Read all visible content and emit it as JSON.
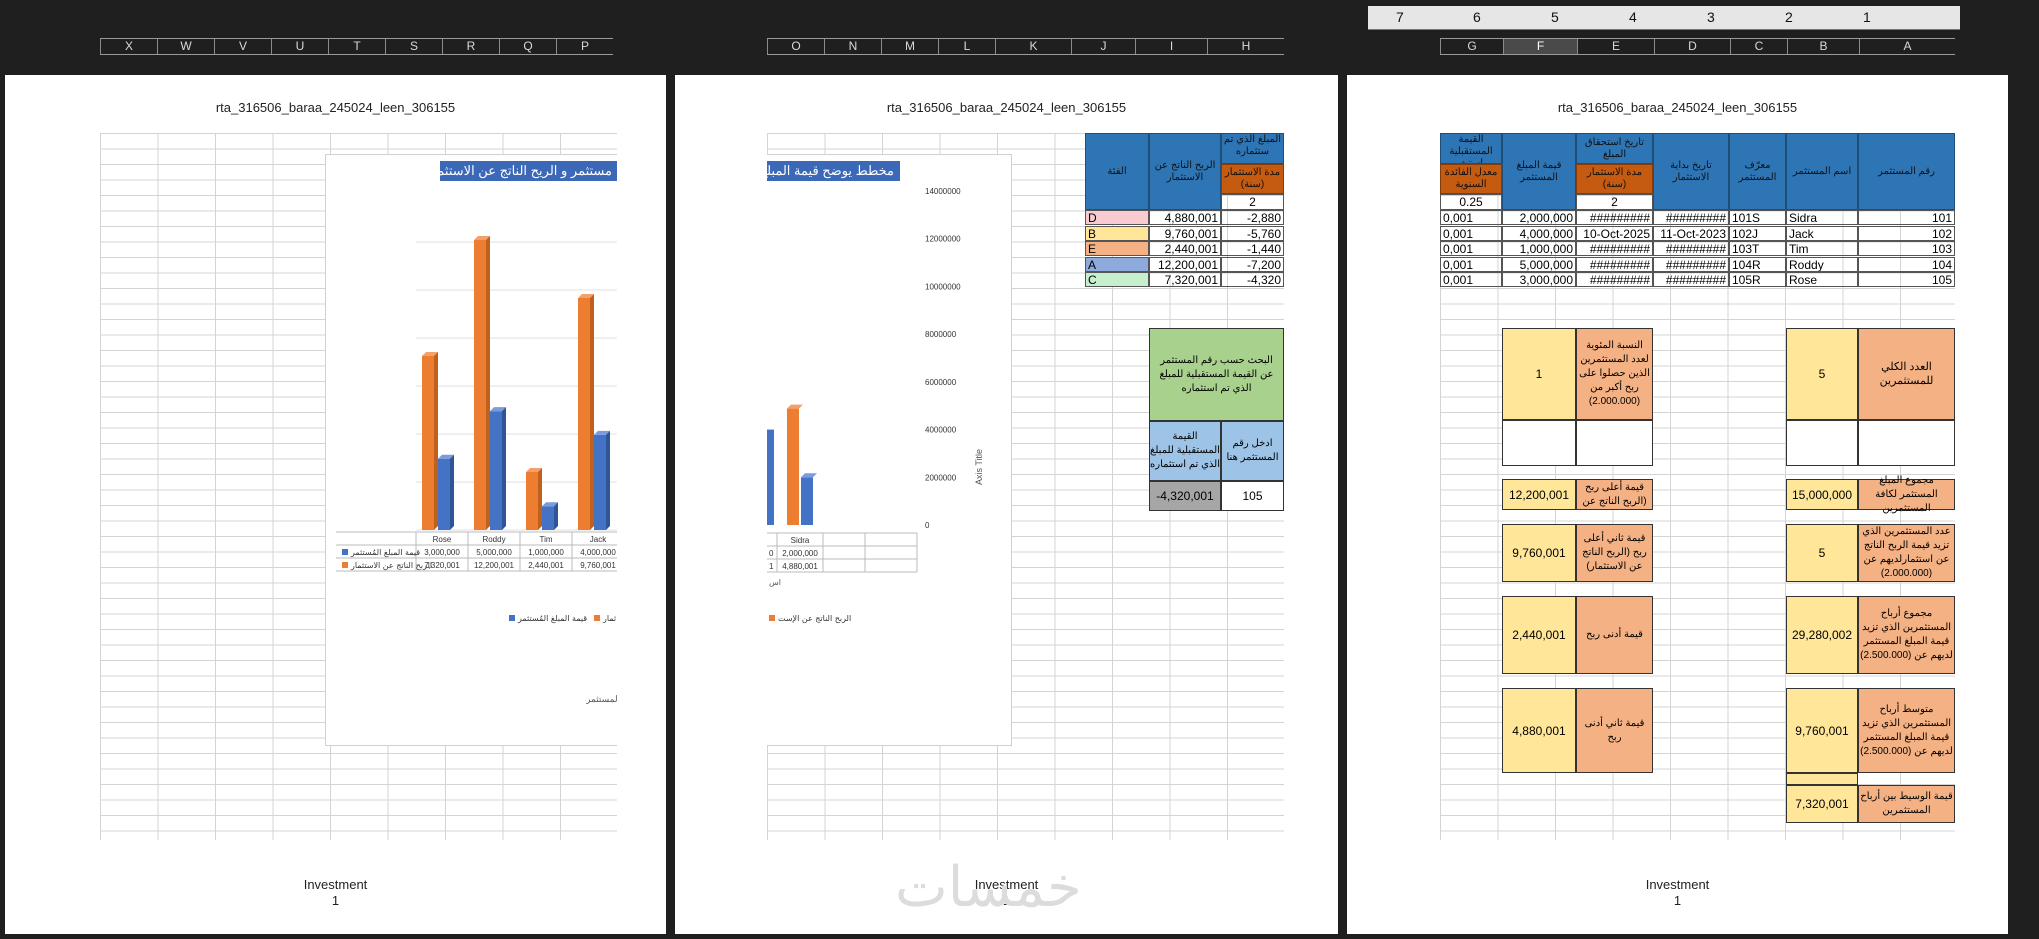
{
  "ruler": {
    "numbers": [
      "7",
      "6",
      "5",
      "4",
      "3",
      "2",
      "1"
    ]
  },
  "column_headers": {
    "left": [
      "X",
      "W",
      "V",
      "U",
      "T",
      "S",
      "R",
      "Q",
      "P"
    ],
    "middle": [
      "O",
      "N",
      "M",
      "L",
      "K",
      "J",
      "I",
      "H"
    ],
    "right": [
      "G",
      "F",
      "E",
      "D",
      "C",
      "B",
      "A"
    ],
    "selected": "F"
  },
  "pages": [
    {
      "title": "rta_316506_baraa_245024_leen_306155",
      "footer_name": "Investment",
      "footer_page": "1"
    },
    {
      "title": "rta_316506_baraa_245024_leen_306155",
      "footer_name": "Investment",
      "footer_page": "1"
    },
    {
      "title": "rta_316506_baraa_245024_leen_306155",
      "footer_name": "Investment",
      "footer_page": "1"
    }
  ],
  "chart_left": {
    "title": "مستثمر و الريح الناتج عن الاستثمار",
    "categories": [
      "Rose",
      "Roddy",
      "Tim",
      "Jack"
    ],
    "row_labels": [
      "قيمة المبلغ المُستثمر",
      "الربح الناتج عن الاستثمار"
    ],
    "row_values_invest": [
      "3,000,000",
      "5,000,000",
      "1,000,000",
      "4,000,000"
    ],
    "row_values_profit": [
      "7,320,001",
      "12,200,001",
      "2,440,001",
      "9,760,001"
    ],
    "axis_caption": "م المستثمر",
    "legend": [
      "قيمة المبلغ المُستثمر",
      "ثمار"
    ]
  },
  "chart_mid": {
    "title": "مخطط يوضح قيمة المبلغ ال",
    "y_ticks": [
      "14000000",
      "12000000",
      "10000000",
      "8000000",
      "6000000",
      "4000000",
      "2000000",
      "0"
    ],
    "y_axis_title": "Axis Title",
    "category": "Sidra",
    "row1": [
      "0",
      "2,000,000"
    ],
    "row2": [
      "1",
      "4,880,001"
    ],
    "axis_caption": "اس",
    "legend": "الربح الناتج عن الإست"
  },
  "chart_data": [
    {
      "type": "bar",
      "title": "مستثمر و الريح الناتج عن الاستثمار",
      "categories": [
        "Rose",
        "Roddy",
        "Tim",
        "Jack"
      ],
      "series": [
        {
          "name": "قيمة المبلغ المُستثمر",
          "values": [
            3000000,
            5000000,
            1000000,
            4000000
          ],
          "color": "#4472c4"
        },
        {
          "name": "الربح الناتج عن الاستثمار",
          "values": [
            7320001,
            12200001,
            2440001,
            9760001
          ],
          "color": "#ed7d31"
        }
      ]
    },
    {
      "type": "bar",
      "title": "مخطط يوضح قيمة المبلغ ال",
      "ylabel": "Axis Title",
      "ylim": [
        0,
        14000000
      ],
      "categories": [
        "Sidra"
      ],
      "series": [
        {
          "name": "قيمة المبلغ المُستثمر",
          "values": [
            2000000
          ],
          "color": "#4472c4"
        },
        {
          "name": "الربح الناتج عن الاستثمار",
          "values": [
            4880001
          ],
          "color": "#ed7d31"
        }
      ]
    }
  ],
  "mid_table": {
    "headers": [
      "الفئة",
      "الربح الناتج عن الاستثمار",
      "المبلغ الذي تم ستثماره"
    ],
    "sub_header": "مدة الاستثمار (سنة)",
    "sub_value": "2",
    "rows": [
      {
        "cat": "D",
        "profit": "4,880,001",
        "x": "-2,880",
        "color": "#f8cbd0"
      },
      {
        "cat": "B",
        "profit": "9,760,001",
        "x": "-5,760",
        "color": "#ffe699"
      },
      {
        "cat": "E",
        "profit": "2,440,001",
        "x": "-1,440",
        "color": "#f4b183"
      },
      {
        "cat": "A",
        "profit": "12,200,001",
        "x": "-7,200",
        "color": "#8ea9db"
      },
      {
        "cat": "C",
        "profit": "7,320,001",
        "x": "-4,320",
        "color": "#c6efce"
      }
    ],
    "search_title": "البحث حسب رقم المستثمر عن القيمة المستقبلية للمبلغ الذي تم استثماره",
    "search_label_left": "القيمة المستقبلية للمبلغ الذي تم استثماره",
    "search_label_right": "ادخل رقم المستثمر هنا",
    "search_result": "-4,320,001",
    "search_input": "105"
  },
  "right_table": {
    "headers": [
      "رقم المستثمر",
      "اسم المستثمر",
      "معرّف المستثمر",
      "تاريخ بداية الاستثمار",
      "تاريخ استحقاق المبلغ",
      "قيمة المبلغ المستثمر",
      "القيمة المستقبلية استث"
    ],
    "sub_header_e": "مدة الاستثمار (سنة)",
    "sub_value_e": "2",
    "sub_header_g": "معدل الفائدة السنوية",
    "sub_value_g": "0.25",
    "rows": [
      {
        "num": "101",
        "name": "Sidra",
        "id": "101S",
        "start": "#########",
        "due": "#########",
        "amount": "2,000,000",
        "future": "0,001"
      },
      {
        "num": "102",
        "name": "Jack",
        "id": "102J",
        "start": "11-Oct-2023",
        "due": "10-Oct-2025",
        "amount": "4,000,000",
        "future": "0,001"
      },
      {
        "num": "103",
        "name": "Tim",
        "id": "103T",
        "start": "#########",
        "due": "#########",
        "amount": "1,000,000",
        "future": "0,001"
      },
      {
        "num": "104",
        "name": "Roddy",
        "id": "104R",
        "start": "#########",
        "due": "#########",
        "amount": "5,000,000",
        "future": "0,001"
      },
      {
        "num": "105",
        "name": "Rose",
        "id": "105R",
        "start": "#########",
        "due": "#########",
        "amount": "3,000,000",
        "future": "0,001"
      }
    ],
    "stats": {
      "total_label": "العدد الكلي للمستثمرين",
      "total_value": "5",
      "pct_label": "النسبة المئوية لعدد المستثمرين الذين حصلوا على ربح أكبر من (2.000.000)",
      "pct_value": "1",
      "sum_label": "مجموع المبلغ المستثمر لكافة المستثمرين",
      "sum_value": "15,000,000",
      "maxprofit_label": "قيمة أعلى ربح (الربح الناتج عن",
      "maxprofit_value": "12,200,001",
      "count_label": "عدد المستثمرين الذي تزيد قيمة الربح الناتج عن استثمارلديهم عن (2.000.000)",
      "count_value": "5",
      "max2_label": "قيمة ثاني أعلى ربح (الربح الناتج عن الاستثمار)",
      "max2_value": "9,760,001",
      "sumprofit_label": "مجموع أرباح المستثمرين الذي تزيد قيمة المبلغ المستثمر لديهم عن (2.500.000)",
      "sumprofit_value": "29,280,002",
      "min_label": "قيمة أدنى ربح",
      "min_value": "2,440,001",
      "avg_label": "متوسط أرباح المستثمرين الذي تزيد قيمة المبلغ المستثمر لديهم عن (2.500.000)",
      "avg_value": "9,760,001",
      "min2_label": "قيمة ثاني أدنى ربح",
      "min2_value": "4,880,001",
      "median_label": "قيمة الوسيط بين أرباح المستثمرين",
      "median_value": "7,320,001"
    }
  },
  "watermark": "خمسات"
}
